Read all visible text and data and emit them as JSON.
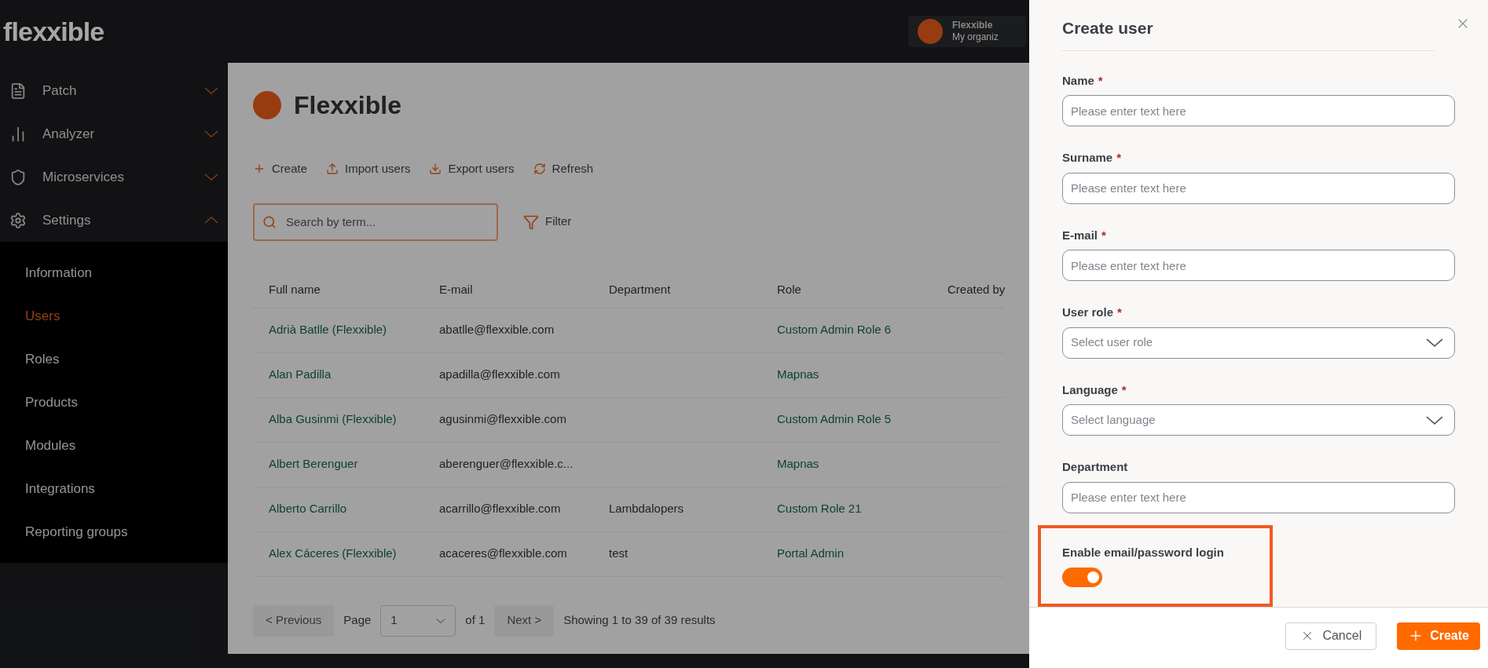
{
  "background": {
    "logo": "flexxible",
    "account": {
      "name": "Flexxible",
      "subtitle": "My organiz"
    },
    "sidebar": {
      "items": [
        {
          "label": "Patch",
          "expanded": false
        },
        {
          "label": "Analyzer",
          "expanded": false
        },
        {
          "label": "Microservices",
          "expanded": false
        },
        {
          "label": "Settings",
          "expanded": true,
          "children": [
            {
              "label": "Information",
              "selected": false
            },
            {
              "label": "Users",
              "selected": true
            },
            {
              "label": "Roles",
              "selected": false
            },
            {
              "label": "Products",
              "selected": false
            },
            {
              "label": "Modules",
              "selected": false
            },
            {
              "label": "Integrations",
              "selected": false
            },
            {
              "label": "Reporting groups",
              "selected": false
            }
          ]
        }
      ]
    },
    "page_title": "Flexxible",
    "toolbar": [
      "Create",
      "Import users",
      "Export users",
      "Refresh"
    ],
    "search": {
      "placeholder": "Search by term..."
    },
    "filter": "Filter",
    "table": {
      "columns": [
        "Full name",
        "E-mail",
        "Department",
        "Role",
        "Created by"
      ],
      "rows": [
        [
          "Adrià Batlle (Flexxible)",
          "abatlle@flexxible.com",
          "",
          "Custom Admin Role 6"
        ],
        [
          "Alan Padilla",
          "apadilla@flexxible.com",
          "",
          "Mapnas"
        ],
        [
          "Alba Gusinmi (Flexxible)",
          "agusinmi@flexxible.com",
          "",
          "Custom Admin Role 5"
        ],
        [
          "Albert Berenguer",
          "aberenguer@flexxible.c...",
          "",
          "Mapnas"
        ],
        [
          "Alberto Carrillo",
          "acarrillo@flexxible.com",
          "Lambdalopers",
          "Custom Role 21"
        ],
        [
          "Alex Cáceres (Flexxible)",
          "acaceres@flexxible.com",
          "test",
          "Portal Admin"
        ]
      ]
    },
    "pagination": {
      "previous": "< Previous",
      "page_label": "Page",
      "page": "1",
      "of": "of 1",
      "next": "Next >",
      "summary": "Showing 1 to 39 of 39 results"
    }
  },
  "drawer": {
    "title": "Create user",
    "required_mark": "*",
    "fields": [
      {
        "kind": "text",
        "label": "Name",
        "required": true,
        "placeholder": "Please enter text here"
      },
      {
        "kind": "text",
        "label": "Surname",
        "required": true,
        "placeholder": "Please enter text here"
      },
      {
        "kind": "text",
        "label": "E-mail",
        "required": true,
        "placeholder": "Please enter text here"
      },
      {
        "kind": "select",
        "label": "User role",
        "required": true,
        "placeholder": "Select user role"
      },
      {
        "kind": "select",
        "label": "Language",
        "required": true,
        "placeholder": "Select language"
      },
      {
        "kind": "text",
        "label": "Department",
        "required": false,
        "placeholder": "Please enter text here"
      }
    ],
    "toggle": {
      "label": "Enable email/password login",
      "on": true,
      "highlighted": true
    },
    "buttons": [
      {
        "kind": "secondary",
        "label": "Cancel"
      },
      {
        "kind": "primary",
        "label": "Create"
      }
    ]
  }
}
